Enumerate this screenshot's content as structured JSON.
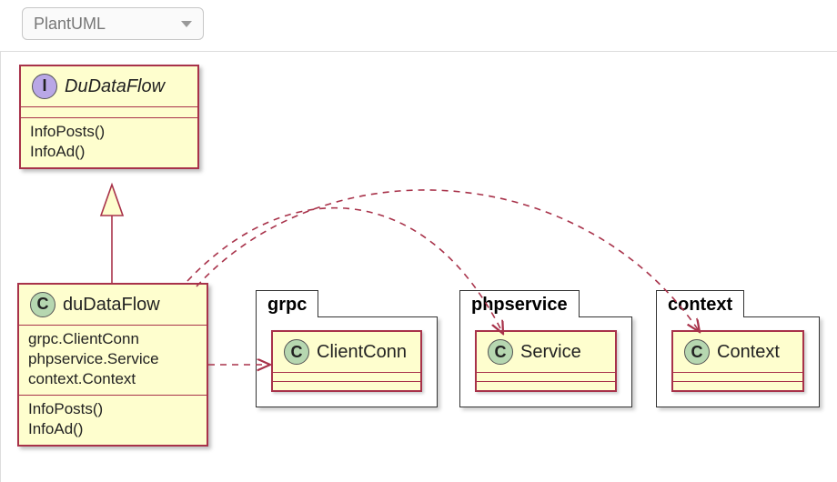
{
  "selector": {
    "value": "PlantUML"
  },
  "diagram": {
    "interface": {
      "name": "DuDataFlow",
      "stereotype": "I",
      "methods": [
        "InfoPosts()",
        "InfoAd()"
      ]
    },
    "class": {
      "name": "duDataFlow",
      "stereotype": "C",
      "fields": [
        "grpc.ClientConn",
        "phpservice.Service",
        "context.Context"
      ],
      "methods": [
        "InfoPosts()",
        "InfoAd()"
      ]
    },
    "packages": [
      {
        "name": "grpc",
        "inner": {
          "stereotype": "C",
          "name": "ClientConn"
        }
      },
      {
        "name": "phpservice",
        "inner": {
          "stereotype": "C",
          "name": "Service"
        }
      },
      {
        "name": "context",
        "inner": {
          "stereotype": "C",
          "name": "Context"
        }
      }
    ],
    "relations": [
      {
        "kind": "realization",
        "from": "duDataFlow",
        "to": "DuDataFlow"
      },
      {
        "kind": "dependency",
        "from": "duDataFlow",
        "to": "grpc.ClientConn"
      },
      {
        "kind": "dependency",
        "from": "duDataFlow",
        "to": "phpservice.Service"
      },
      {
        "kind": "dependency",
        "from": "duDataFlow",
        "to": "context.Context"
      }
    ]
  }
}
